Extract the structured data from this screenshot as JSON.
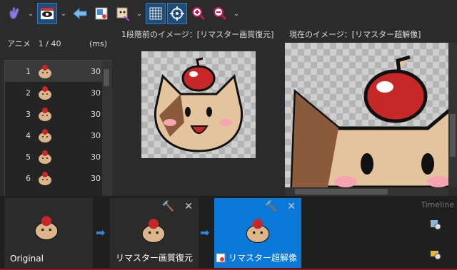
{
  "toolbar": {
    "items": [
      "hand-tool",
      "chevron",
      "view-toggle",
      "chevron",
      "back-arrow",
      "image-tool",
      "edit-image",
      "chevron",
      "grid",
      "target",
      "zoom-in",
      "zoom-out",
      "chevron"
    ]
  },
  "left": {
    "header": "アニメ　1 / 40",
    "unit": "(ms)",
    "rows": [
      {
        "n": "1",
        "v": "30"
      },
      {
        "n": "2",
        "v": "30"
      },
      {
        "n": "3",
        "v": "30"
      },
      {
        "n": "4",
        "v": "30"
      },
      {
        "n": "5",
        "v": "30"
      },
      {
        "n": "6",
        "v": "30"
      }
    ]
  },
  "prev": {
    "title": "1段階前のイメージ：[リマスター画質復元]"
  },
  "curr": {
    "title": "現在のイメージ：[リマスター超解像]"
  },
  "timeline": {
    "label": "Timeline",
    "cards": [
      {
        "label": "Original"
      },
      {
        "label": "リマスター画質復元"
      },
      {
        "label": "リマスター超解像"
      }
    ]
  }
}
